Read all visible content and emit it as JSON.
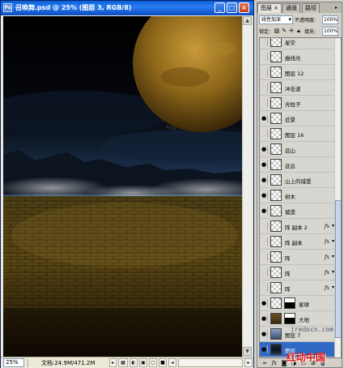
{
  "document": {
    "title": "召唤舞.psd @ 25% (图层 3, RGB/8)",
    "icon": "photoshop-doc-icon",
    "buttons": {
      "minimize": "_",
      "maximize": "□",
      "close": "×"
    }
  },
  "status": {
    "zoom": "25%",
    "doc_info": "文档:24.9M/471.2M"
  },
  "panel": {
    "tabs": [
      {
        "label": "图层",
        "close": "×"
      },
      {
        "label": "通道"
      },
      {
        "label": "路径"
      }
    ],
    "blend_mode": "线性加深",
    "opacity_label": "不透明度:",
    "opacity_value": "100%",
    "lock_label": "锁定:",
    "fill_label": "填充:",
    "fill_value": "100%",
    "layers": [
      {
        "name": "星空",
        "visible": false,
        "thumb": "transparent"
      },
      {
        "name": "曲线光",
        "visible": false,
        "thumb": "transparent"
      },
      {
        "name": "图层 12",
        "visible": false,
        "thumb": "transparent"
      },
      {
        "name": "冲击波",
        "visible": false,
        "thumb": "transparent"
      },
      {
        "name": "光柱子",
        "visible": false,
        "thumb": "transparent"
      },
      {
        "name": "近景",
        "visible": true,
        "thumb": "transparent"
      },
      {
        "name": "图层 16",
        "visible": false,
        "thumb": "transparent"
      },
      {
        "name": "远山",
        "visible": true,
        "thumb": "transparent"
      },
      {
        "name": "远云",
        "visible": true,
        "thumb": "transparent"
      },
      {
        "name": "山上的城堡",
        "visible": true,
        "thumb": "transparent"
      },
      {
        "name": "树木",
        "visible": true,
        "thumb": "transparent"
      },
      {
        "name": "城堡",
        "visible": true,
        "thumb": "transparent"
      },
      {
        "name": "阵 副本 2",
        "visible": false,
        "thumb": "transparent",
        "fx": "fx"
      },
      {
        "name": "阵 副本",
        "visible": false,
        "thumb": "transparent",
        "fx": "fx"
      },
      {
        "name": "阵",
        "visible": false,
        "thumb": "transparent",
        "fx": "fx"
      },
      {
        "name": "阵",
        "visible": false,
        "thumb": "transparent",
        "fx": "fx"
      },
      {
        "name": "阵",
        "visible": false,
        "thumb": "transparent",
        "fx": "fx"
      },
      {
        "name": "星球",
        "visible": true,
        "thumb": "transparent",
        "mask": true
      },
      {
        "name": "大地",
        "visible": true,
        "thumb": "brick",
        "mask": true
      },
      {
        "name": "图层 7",
        "visible": true,
        "thumb": "cloud"
      },
      {
        "name": "图层",
        "visible": true,
        "thumb": "dark",
        "selected": true
      }
    ]
  },
  "watermarks": {
    "site": "jredocn.com",
    "brand": "红动中国"
  }
}
